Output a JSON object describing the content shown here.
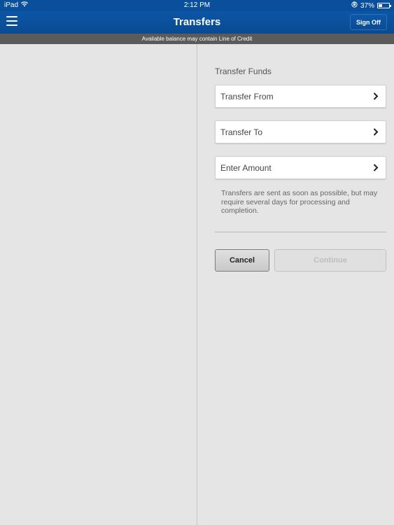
{
  "status_bar": {
    "device": "iPad",
    "time": "2:12 PM",
    "battery_percent": "37%",
    "battery_level": 0.37
  },
  "nav": {
    "title": "Transfers",
    "sign_off_label": "Sign Off"
  },
  "info_bar": {
    "text": "Available balance may contain Line of Credit"
  },
  "transfer": {
    "section_title": "Transfer Funds",
    "rows": [
      {
        "label": "Transfer From"
      },
      {
        "label": "Transfer To"
      },
      {
        "label": "Enter Amount"
      }
    ],
    "note": "Transfers are sent as soon as possible, but may require several days for processing and completion.",
    "cancel_label": "Cancel",
    "continue_label": "Continue"
  },
  "colors": {
    "nav_blue": "#0a4f9c",
    "info_gray": "#5b5b5b",
    "background": "#e5e5e5"
  }
}
